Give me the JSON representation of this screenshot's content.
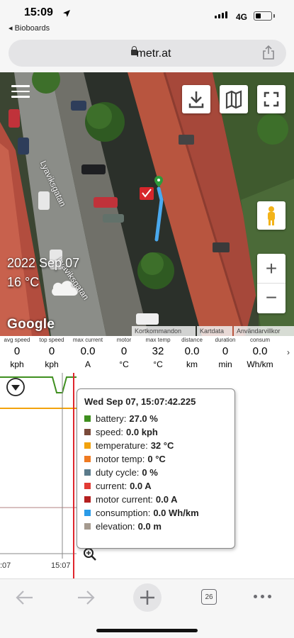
{
  "status_bar": {
    "time": "15:09",
    "back_app": "◂ Bioboards",
    "network": "4G",
    "battery_level": 0.35
  },
  "browser": {
    "url": "metr.at",
    "tab_count": "26"
  },
  "map": {
    "date": "2022 Sep 07",
    "temperature": "16 °C",
    "brand": "Google",
    "streets": [
      "Lyaviksgatan",
      "Lyaviksgatan"
    ],
    "footer": {
      "shortcuts": "Kortkommandon",
      "mapdata": "Kartdata",
      "terms": "Användarvillkor"
    },
    "zoom_in": "+",
    "zoom_out": "−"
  },
  "stats": [
    {
      "label": "avg speed",
      "value": "0",
      "unit": "kph"
    },
    {
      "label": "top speed",
      "value": "0",
      "unit": "kph"
    },
    {
      "label": "max current",
      "value": "0.0",
      "unit": "A"
    },
    {
      "label": "motor",
      "value": "0",
      "unit": "°C"
    },
    {
      "label": "max temp",
      "value": "32",
      "unit": "°C"
    },
    {
      "label": "distance",
      "value": "0.0",
      "unit": "km"
    },
    {
      "label": "duration",
      "value": "0",
      "unit": "min"
    },
    {
      "label": "consum",
      "value": "0.0",
      "unit": "Wh/km"
    }
  ],
  "chart": {
    "tooltip_title": "Wed Sep 07, 15:07:42.225",
    "rows": [
      {
        "key": "battery:",
        "value": "27.0 %",
        "color": "#3f8f1f"
      },
      {
        "key": "speed:",
        "value": "0.0 kph",
        "color": "#7a4a3a"
      },
      {
        "key": "temperature:",
        "value": "32 °C",
        "color": "#f2a20c"
      },
      {
        "key": "motor temp:",
        "value": "0 °C",
        "color": "#ef7a22"
      },
      {
        "key": "duty cycle:",
        "value": "0 %",
        "color": "#5b7b8b"
      },
      {
        "key": "current:",
        "value": "0.0 A",
        "color": "#e23b35"
      },
      {
        "key": "motor current:",
        "value": "0.0 A",
        "color": "#b42020"
      },
      {
        "key": "consumption:",
        "value": "0.0 Wh/km",
        "color": "#2a9be8"
      },
      {
        "key": "elevation:",
        "value": "0.0 m",
        "color": "#a59a8f"
      }
    ],
    "x_labels": [
      ":07",
      "15:07"
    ]
  }
}
